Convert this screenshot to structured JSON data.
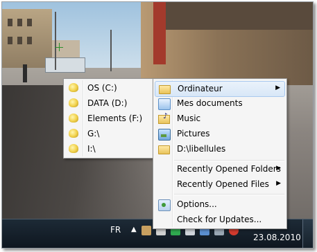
{
  "drives_menu": {
    "items": [
      {
        "label": "OS (C:)",
        "icon": "drive-icon"
      },
      {
        "label": "DATA (D:)",
        "icon": "drive-icon"
      },
      {
        "label": "Elements (F:)",
        "icon": "drive-icon"
      },
      {
        "label": "G:\\",
        "icon": "drive-icon"
      },
      {
        "label": "I:\\",
        "icon": "drive-icon"
      }
    ]
  },
  "main_menu": {
    "items": [
      {
        "label": "Ordinateur",
        "icon": "folder-icon",
        "highlighted": true,
        "has_submenu": true
      },
      {
        "label": "Mes documents",
        "icon": "documents-icon"
      },
      {
        "label": "Music",
        "icon": "music-folder-icon"
      },
      {
        "label": "Pictures",
        "icon": "pictures-icon"
      },
      {
        "label": "D:\\libellules",
        "icon": "folder-icon"
      }
    ],
    "recent": [
      {
        "label": "Recently Opened Folders",
        "has_submenu": true
      },
      {
        "label": "Recently Opened Files",
        "has_submenu": true
      }
    ],
    "bottom": [
      {
        "label": "Options...",
        "icon": "options-icon"
      },
      {
        "label": "Check for Updates..."
      }
    ]
  },
  "taskbar": {
    "language": "FR",
    "date": "23.08.2010"
  },
  "colors": {
    "menu_bg": "#f5f5f5",
    "highlight": "#d8e7f7",
    "taskbar": "#0e161f"
  }
}
